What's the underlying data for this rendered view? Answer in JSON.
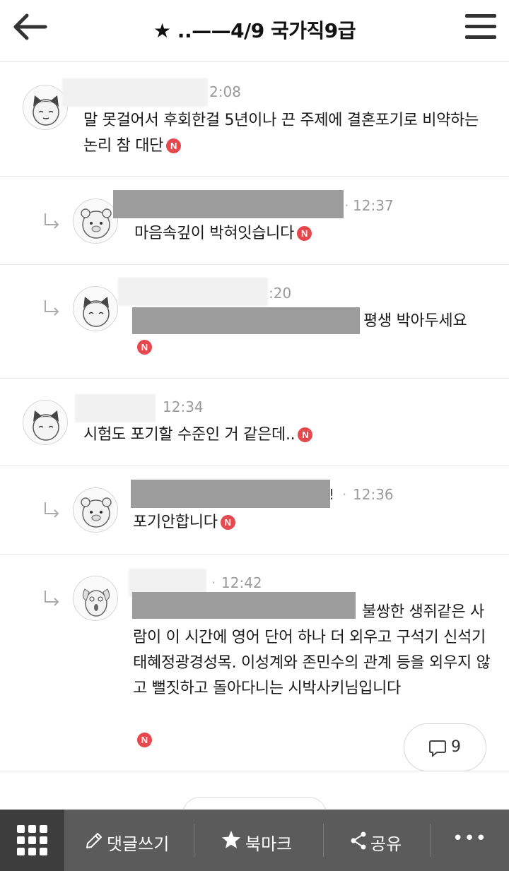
{
  "header": {
    "title": "★ ..——4/9 국가직9급",
    "back_icon": "back-arrow-icon",
    "menu_icon": "hamburger-menu-icon"
  },
  "comments": [
    {
      "time": "2:08",
      "text": "말 못걸어서 후회한걸 5년이나 끈 주제에 결혼포기로 비약하는 논리 참 대단",
      "badge": "N",
      "reply": false
    },
    {
      "time": "12:37",
      "text": "마음속깊이 박혀잇습니다",
      "badge": "N",
      "reply": true
    },
    {
      "time": ":20",
      "text": "평생 박아두세요",
      "badge": "N",
      "reply": true
    },
    {
      "time": "12:34",
      "text": "시험도 포기할 수준인 거 같은데..",
      "badge": "N",
      "reply": false
    },
    {
      "time": "12:36",
      "name_tail": "!",
      "text": "포기안합니다",
      "badge": "N",
      "reply": true
    },
    {
      "time": "12:42",
      "text": "불쌍한 생쥐같은 사람이 이 시간에 영어 단어 하나 더 외우고 구석기 신석기 태혜정광경성목. 이성계와 존민수의 관계 등을 외우지 않고 뻘짓하고 돌아다니는 시박사키님입니다",
      "badge": "N",
      "reply": true
    }
  ],
  "reply_count": "9",
  "toolbar": {
    "write_label": "댓글쓰기",
    "bookmark_label": "북마크",
    "share_label": "공유",
    "more_label": "•••"
  },
  "colors": {
    "badge": "#e5484d",
    "toolbar_bg": "#5b5b5b",
    "toolbar_grid_bg": "#3d3d3d"
  }
}
